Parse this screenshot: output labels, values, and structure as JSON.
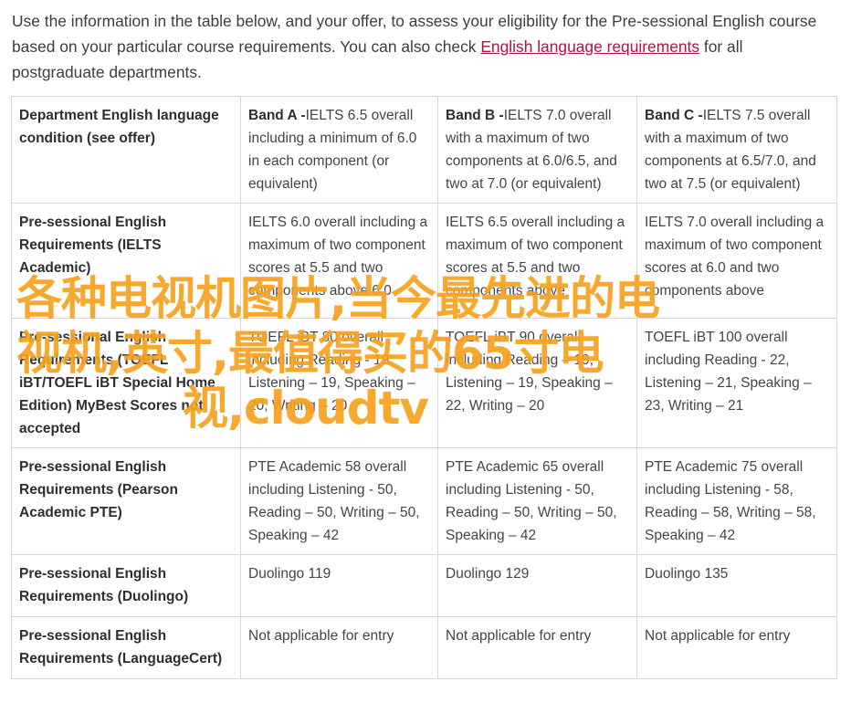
{
  "intro": {
    "text_before": "Use the information in the table below, and your offer, to assess your eligibility for the Pre-sessional English course based on your particular course requirements. You can also check ",
    "link": "English language requirements",
    "text_after": " for all postgraduate departments."
  },
  "table": {
    "rows": [
      {
        "label": "Department English language condition (see offer)",
        "cells": [
          {
            "band": "Band A -",
            "text": "IELTS 6.5 overall including a minimum of 6.0 in each component (or equivalent)"
          },
          {
            "band": "Band B -",
            "text": "IELTS 7.0 overall with a maximum of two components at 6.0/6.5, and two at 7.0 (or equivalent)"
          },
          {
            "band": "Band C -",
            "text": "IELTS 7.5 overall with a maximum of two components at 6.5/7.0, and two at 7.5 (or equivalent)"
          }
        ]
      },
      {
        "label": "Pre-sessional English Requirements (IELTS Academic)",
        "cells": [
          {
            "text": "IELTS 6.0 overall including a maximum of two component scores at 5.5 and two components above 6.0"
          },
          {
            "text": "IELTS 6.5 overall including a maximum of two component scores at 5.5 and two components above"
          },
          {
            "text": "IELTS 7.0 overall including a maximum of two component scores at 6.0 and two components above"
          }
        ]
      },
      {
        "label": "Pre-sessional English Requirements (TOEFL iBT/TOEFL iBT Special Home Edition) MyBest Scores not accepted",
        "cells": [
          {
            "text": "TOEFL iBT 80 overall including Reading - 19, Listening – 19, Speaking – 20, Writing – 20"
          },
          {
            "text": "TOEFL iBT 90 overall including Reading – 19, Listening – 19, Speaking – 22, Writing – 20"
          },
          {
            "text": "TOEFL iBT 100 overall including Reading - 22, Listening – 21, Speaking – 23, Writing – 21"
          }
        ]
      },
      {
        "label": "Pre-sessional English Requirements (Pearson Academic PTE)",
        "cells": [
          {
            "text": "PTE Academic 58 overall including Listening - 50, Reading – 50, Writing – 50, Speaking – 42"
          },
          {
            "text": "PTE Academic 65 overall including Listening - 50, Reading – 50, Writing – 50, Speaking – 42"
          },
          {
            "text": "PTE Academic 75 overall including Listening - 58, Reading – 58, Writing – 58, Speaking – 42"
          }
        ]
      },
      {
        "label": "Pre-sessional English Requirements (Duolingo)",
        "cells": [
          {
            "text": "Duolingo 119"
          },
          {
            "text": "Duolingo 129"
          },
          {
            "text": "Duolingo 135"
          }
        ]
      },
      {
        "label": "Pre-sessional English Requirements (LanguageCert)",
        "cells": [
          {
            "text": "Not applicable for entry"
          },
          {
            "text": "Not applicable for entry"
          },
          {
            "text": "Not applicable for entry"
          }
        ]
      }
    ]
  },
  "watermark": {
    "line1": "各种电视机图片,当今最先进的电",
    "line2": "视机,英寸,最值得买的65寸电",
    "line3": "视,cloudtv"
  },
  "colors": {
    "link": "#b3143c",
    "watermark": "#f6a21d",
    "border": "#d7d7d7"
  }
}
